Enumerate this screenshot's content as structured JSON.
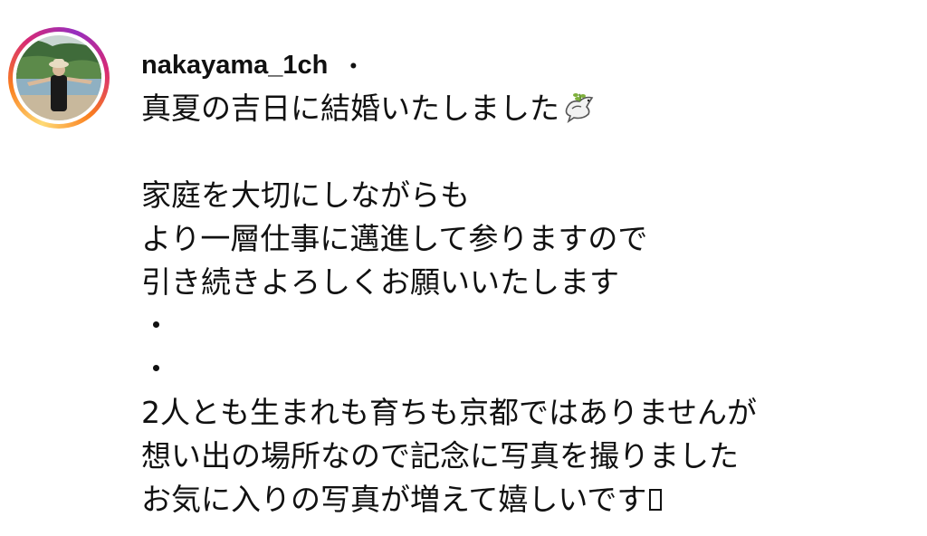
{
  "post": {
    "author": {
      "username": "nakayama_1ch",
      "separator": "・",
      "avatar": "profile-photo-icon",
      "story_ring_colors": [
        "#feda75",
        "#fa7e1e",
        "#d62976",
        "#962fbf"
      ]
    },
    "caption": {
      "lines": [
        "真夏の吉日に結婚いたしました",
        "",
        "家庭を大切にしながらも",
        "より一層仕事に邁進して参りますので",
        "引き続きよろしくお願いいたします",
        "・",
        "・",
        "2人とも生まれも育ちも京都ではありませんが",
        "想い出の場所なので記念に写真を撮りました",
        "お気に入りの写真が増えて嬉しいです"
      ],
      "line1_emoji": "dove-with-olive-branch-icon",
      "last_line_glyph": "missing-glyph-icon"
    }
  }
}
